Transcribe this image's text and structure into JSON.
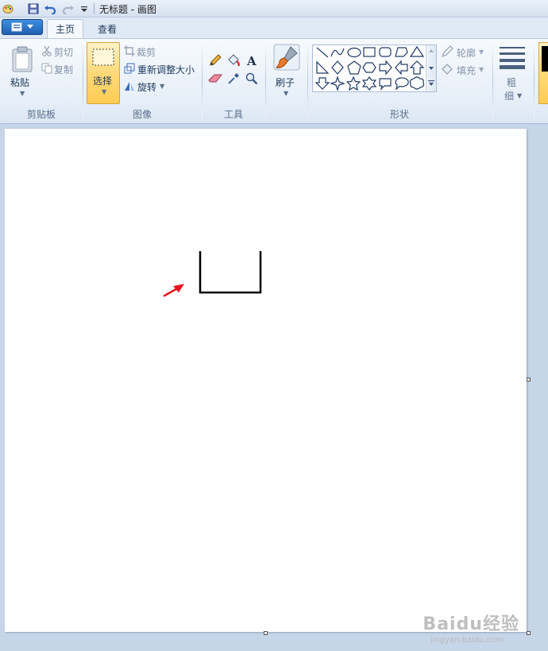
{
  "window": {
    "title": "无标题 - 画图"
  },
  "tabs": [
    {
      "label": "主页"
    },
    {
      "label": "查看"
    }
  ],
  "ribbon": {
    "clipboard": {
      "paste": "粘贴",
      "cut": "剪切",
      "copy": "复制",
      "group": "剪贴板"
    },
    "image": {
      "select": "选择",
      "crop": "裁剪",
      "resize": "重新调整大小",
      "rotate": "旋转",
      "group": "图像"
    },
    "tools": {
      "group": "工具"
    },
    "brushes": {
      "label": "刷子"
    },
    "shapes": {
      "outline": "轮廓",
      "fill": "填充",
      "group": "形状"
    },
    "size": {
      "line1": "粗",
      "line2": "细"
    }
  },
  "watermark": {
    "text": "Baidu经验",
    "url": "jingyan.baidu.com"
  },
  "colors": {
    "accent": "#ffd978",
    "arrow": "#e8141e"
  }
}
